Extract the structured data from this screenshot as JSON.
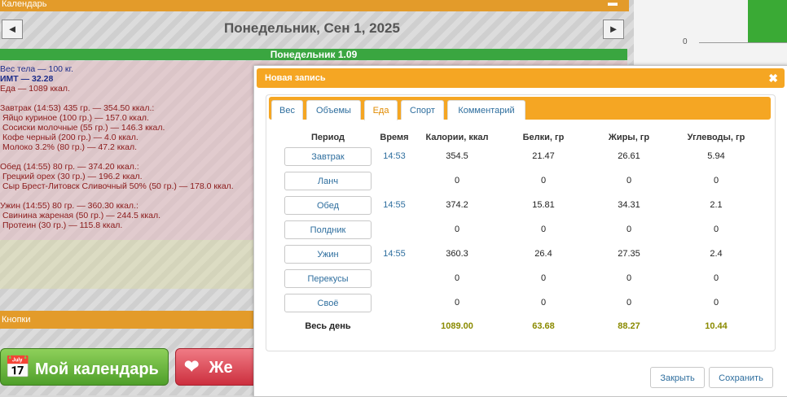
{
  "calendar": {
    "header": "Календарь",
    "date_title": "Понедельник, Сен 1, 2025",
    "day_bar": "Понедельник 1.09",
    "summary": {
      "weight": "Вес тела — 100 кг.",
      "bmi": "ИМТ — 32.28",
      "food_total": "Еда — 1089 ккал.",
      "breakfast": [
        "Завтрак (14:53) 435 гр. — 354.50 ккал.:",
        "Яйцо куриное (100 гр.) — 157.0 ккал.",
        "Сосиски молочные (55 гр.) — 146.3 ккал.",
        "Кофе черный (200 гр.) — 4.0 ккал.",
        "Молоко 3.2% (80 гр.) — 47.2 ккал."
      ],
      "lunch": [
        "Обед (14:55) 80 гр. — 374.20 ккал.:",
        "Грецкий орех (30 гр.) — 196.2 ккал.",
        "Сыр Брест-Литовск Сливочный 50% (50 гр.) — 178.0 ккал."
      ],
      "dinner": [
        "Ужин (14:55) 80 гр. — 360.30 ккал.:",
        "Свинина жареная (50 гр.) — 244.5 ккал.",
        "Протеин (30 гр.) — 115.8 ккал."
      ]
    },
    "buttons_header": "Кнопки",
    "my_calendar_btn": "Мой календарь",
    "second_btn": "Же",
    "chart_zero": "0"
  },
  "modal": {
    "title": "Новая запись",
    "tabs": [
      "Вес",
      "Объемы",
      "Еда",
      "Спорт",
      "Комментарий"
    ],
    "active_tab": "Еда",
    "headers": [
      "Период",
      "Время",
      "Калории, ккал",
      "Белки, гр",
      "Жиры, гр",
      "Углеводы, гр"
    ],
    "rows": [
      {
        "period": "Завтрак",
        "time": "14:53",
        "kcal": "354.5",
        "protein": "21.47",
        "fat": "26.61",
        "carbs": "5.94"
      },
      {
        "period": "Ланч",
        "time": "",
        "kcal": "0",
        "protein": "0",
        "fat": "0",
        "carbs": "0"
      },
      {
        "period": "Обед",
        "time": "14:55",
        "kcal": "374.2",
        "protein": "15.81",
        "fat": "34.31",
        "carbs": "2.1"
      },
      {
        "period": "Полдник",
        "time": "",
        "kcal": "0",
        "protein": "0",
        "fat": "0",
        "carbs": "0"
      },
      {
        "period": "Ужин",
        "time": "14:55",
        "kcal": "360.3",
        "protein": "26.4",
        "fat": "27.35",
        "carbs": "2.4"
      },
      {
        "period": "Перекусы",
        "time": "",
        "kcal": "0",
        "protein": "0",
        "fat": "0",
        "carbs": "0"
      },
      {
        "period": "Своё",
        "time": "",
        "kcal": "0",
        "protein": "0",
        "fat": "0",
        "carbs": "0"
      }
    ],
    "total": {
      "label": "Весь день",
      "kcal": "1089.00",
      "protein": "63.68",
      "fat": "88.27",
      "carbs": "10.44"
    },
    "close_btn": "Закрыть",
    "save_btn": "Сохранить"
  },
  "icons": {
    "prev": "left-arrow-icon",
    "next": "right-arrow-icon",
    "close": "close-icon",
    "minimize": "minimize-icon"
  },
  "colors": {
    "accent": "#f5a623",
    "green": "#3aa640",
    "link": "#2e6e9e",
    "total": "#8a8a00"
  }
}
